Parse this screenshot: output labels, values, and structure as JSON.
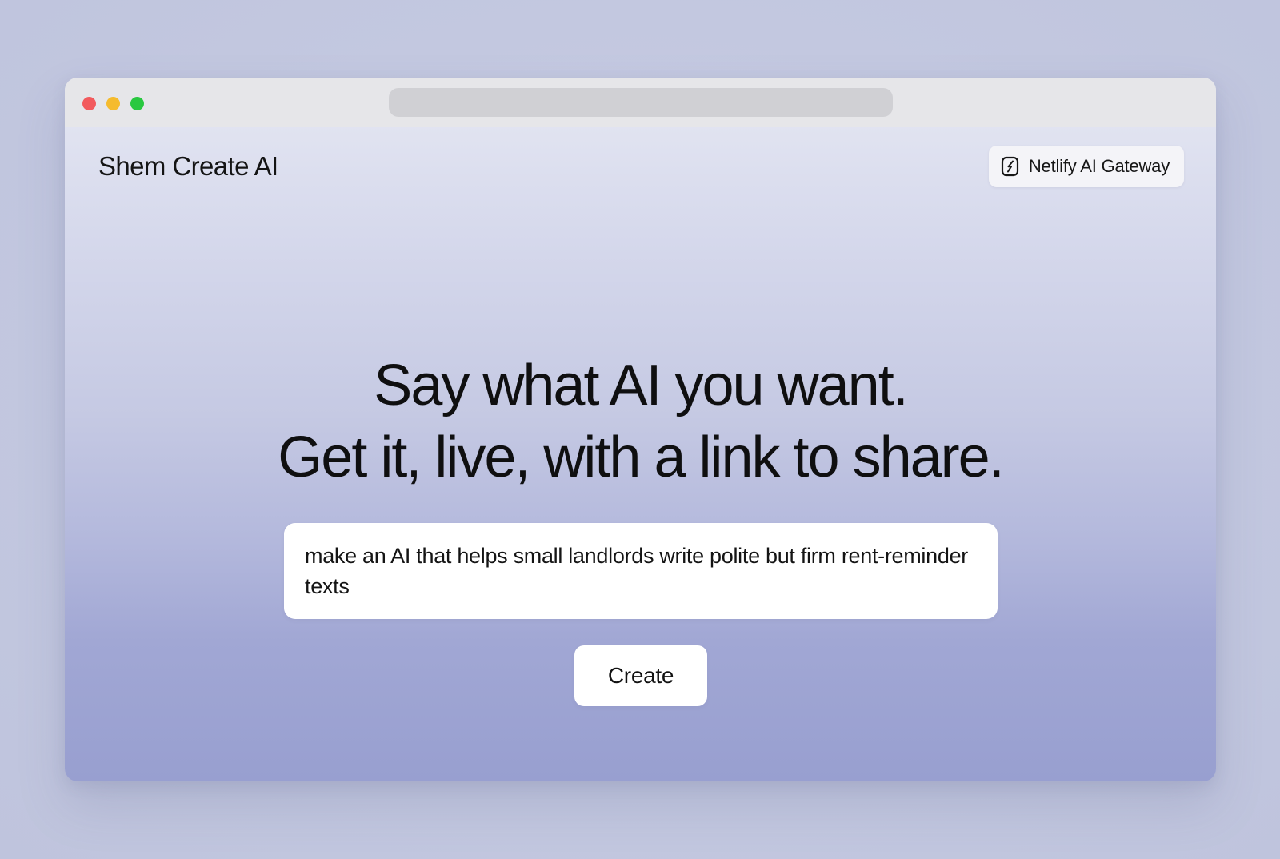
{
  "window": {
    "traffic_lights": [
      "close-red",
      "minimize-yellow",
      "maximize-green"
    ],
    "address_bar": {
      "placeholder": ""
    }
  },
  "header": {
    "brand": "Shem Create AI",
    "gateway_badge": {
      "label": "Netlify AI Gateway",
      "icon": "netlify-icon"
    }
  },
  "hero": {
    "line1": "Say what AI you want.",
    "line2": "Get it, live, with a link to share."
  },
  "prompt": {
    "value": "make an AI that helps small landlords write polite but firm rent-reminder texts",
    "placeholder": ""
  },
  "actions": {
    "create_label": "Create"
  },
  "colors": {
    "traffic_red": "#f25a5d",
    "traffic_yellow": "#f5bb2d",
    "traffic_green": "#29c840",
    "titlebar": "#e6e6e9",
    "gradient_top": "#e6e8f3",
    "gradient_bottom": "#989fd0"
  }
}
